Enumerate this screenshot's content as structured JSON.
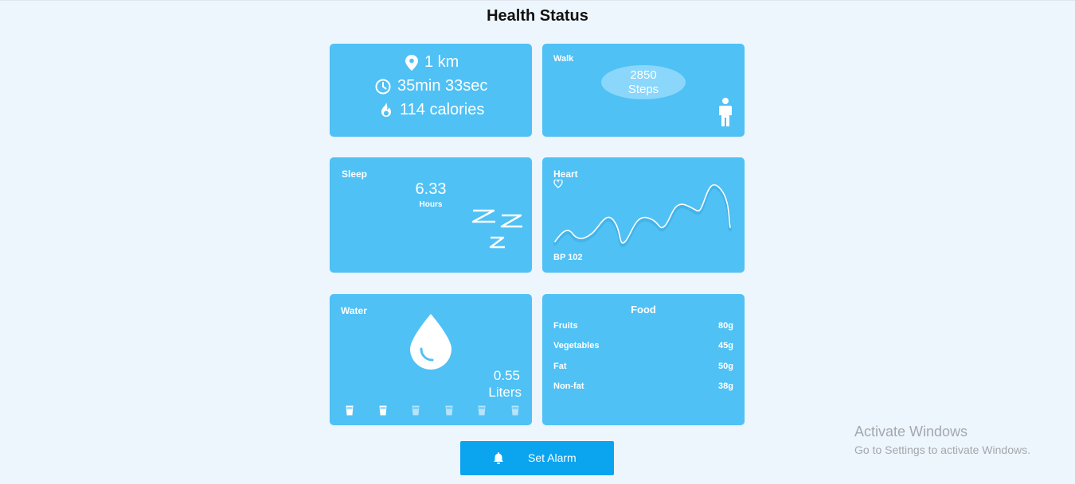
{
  "page": {
    "title": "Health Status"
  },
  "activity": {
    "distance": "1 km",
    "duration": "35min 33sec",
    "calories": "114 calories"
  },
  "walk": {
    "label": "Walk",
    "steps_value": "2850",
    "steps_unit": "Steps"
  },
  "sleep": {
    "label": "Sleep",
    "value": "6.33",
    "unit": "Hours"
  },
  "heart": {
    "label": "Heart",
    "bp": "BP 102"
  },
  "water": {
    "label": "Water",
    "value": "0.55",
    "unit": "Liters",
    "glasses_filled": 2,
    "glasses_total": 6
  },
  "food": {
    "title": "Food",
    "items": [
      {
        "name": "Fruits",
        "amount": "80g"
      },
      {
        "name": "Vegetables",
        "amount": "45g"
      },
      {
        "name": "Fat",
        "amount": "50g"
      },
      {
        "name": "Non-fat",
        "amount": "38g"
      }
    ]
  },
  "alarm": {
    "label": "Set Alarm"
  },
  "windows": {
    "line1": "Activate Windows",
    "line2": "Go to Settings to activate Windows."
  },
  "colors": {
    "card": "#4fc1f5",
    "button": "#0ba4ef",
    "background": "#eef6fd"
  },
  "icons": [
    "location-pin-icon",
    "clock-icon",
    "flame-icon",
    "person-icon",
    "sleep-zzz-icon",
    "heart-icon",
    "water-drop-icon",
    "glass-icon",
    "bell-icon"
  ]
}
